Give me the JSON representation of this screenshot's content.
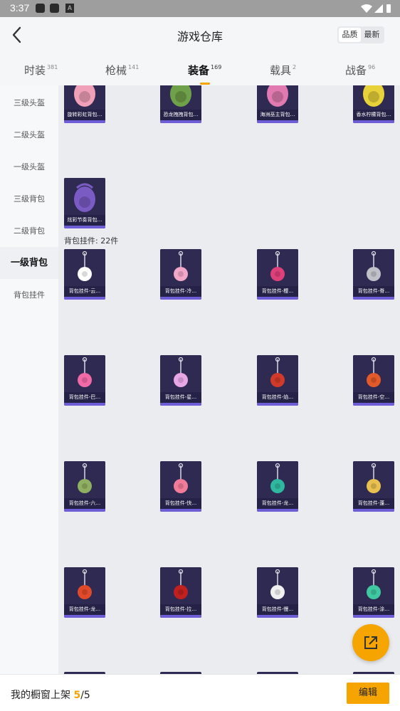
{
  "status_bar": {
    "time": "3:37",
    "notif_letter": "A"
  },
  "header": {
    "title": "游戏仓库",
    "sort_options": [
      "品质",
      "最新"
    ]
  },
  "tabs": [
    {
      "label": "时装",
      "count": "381"
    },
    {
      "label": "枪械",
      "count": "141"
    },
    {
      "label": "装备",
      "count": "169"
    },
    {
      "label": "载具",
      "count": "2"
    },
    {
      "label": "战备",
      "count": "96"
    }
  ],
  "sidebar": [
    "三级头盔",
    "二级头盔",
    "一级头盔",
    "三级背包",
    "二级背包",
    "一级背包",
    "背包挂件"
  ],
  "backpacks": [
    {
      "label": "旋转彩虹背包…",
      "color": "#f0a0b8"
    },
    {
      "label": "恐龙拽拽背包…",
      "color": "#6fa04a"
    },
    {
      "label": "海洲巫主背包…",
      "color": "#e07ab0"
    },
    {
      "label": "香水柠檬背包…",
      "color": "#e8d23a"
    },
    {
      "label": "炫彩节奏背包…",
      "color": "#7a5bc4"
    }
  ],
  "section_label": "背包挂件: 22件",
  "charms": [
    {
      "label": "背包挂件-云…",
      "color": "#ffffff"
    },
    {
      "label": "背包挂件-冷…",
      "color": "#f2a6c8"
    },
    {
      "label": "背包挂件-樱…",
      "color": "#e0407a"
    },
    {
      "label": "背包挂件-脊…",
      "color": "#c0c0c8"
    },
    {
      "label": "背包挂件-巴…",
      "color": "#f06aa8"
    },
    {
      "label": "背包挂件-星…",
      "color": "#e8a8e8"
    },
    {
      "label": "背包挂件-焰…",
      "color": "#d03a2a"
    },
    {
      "label": "背包挂件-空…",
      "color": "#e2592a"
    },
    {
      "label": "背包挂件-六…",
      "color": "#8fb060"
    },
    {
      "label": "背包挂件-快…",
      "color": "#f07c9a"
    },
    {
      "label": "背包挂件-龙…",
      "color": "#2fb8a0"
    },
    {
      "label": "背包挂件-蓬…",
      "color": "#e8c050"
    },
    {
      "label": "背包挂件-龙…",
      "color": "#e04a2a"
    },
    {
      "label": "背包挂件-拉…",
      "color": "#c02020"
    },
    {
      "label": "背包挂件-慢…",
      "color": "#f0f0f0"
    },
    {
      "label": "背包挂件-涂…",
      "color": "#40c8a0"
    }
  ],
  "bottom_bar": {
    "text": "我的橱窗上架 ",
    "count": "5",
    "total": "/5",
    "edit_label": "编辑"
  }
}
